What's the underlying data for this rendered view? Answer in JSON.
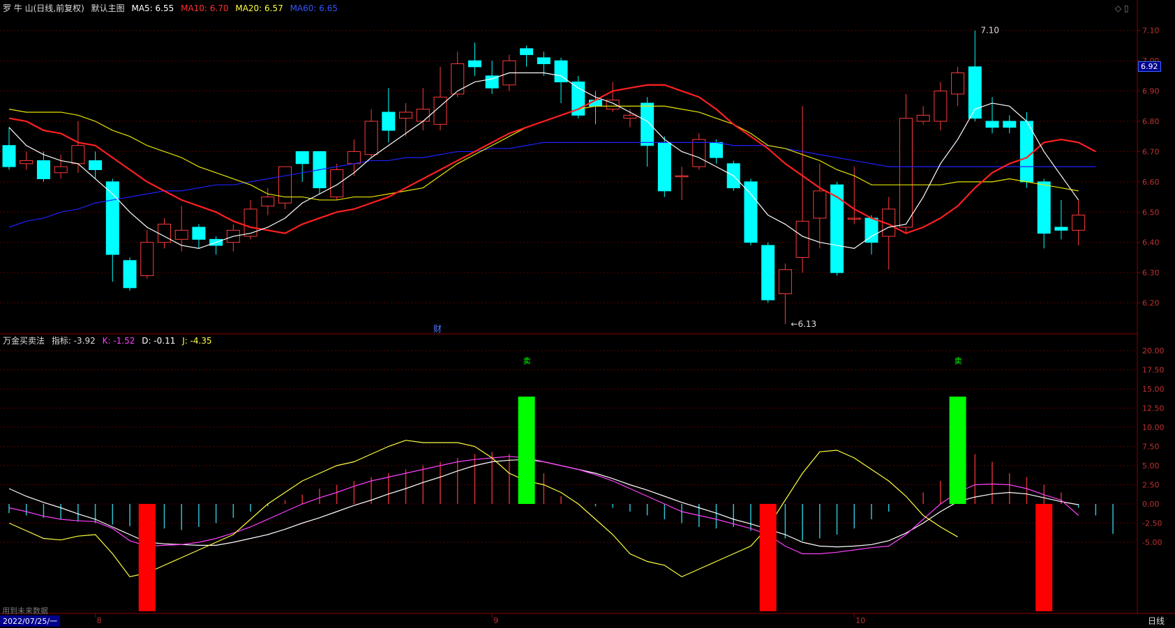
{
  "top_header": {
    "stock": "罗 牛 山(日线,前复权)",
    "main_chart": "默认主图",
    "ma5": "MA5: 6.55",
    "ma10": "MA10: 6.70",
    "ma20": "MA20: 6.57",
    "ma60": "MA60: 6.65"
  },
  "sub_header": {
    "indicator": "万金买卖法",
    "value": "指标: -3.92",
    "k": "K: -1.52",
    "d": "D: -0.11",
    "j": "J: -4.35"
  },
  "price_badge": "6.92",
  "finance_mark": "财",
  "future_data_label": "用到未来数据",
  "date_box": "2022/07/25/一",
  "period_button": "日线",
  "colors": {
    "bg": "#000000",
    "up": "#ff3b3b",
    "down": "#00ffff",
    "ma5": "#ffffff",
    "ma10": "#ff2020",
    "ma20": "#e6e600",
    "ma60": "#2020ff",
    "k": "#ff40ff",
    "d": "#ffffff",
    "j": "#ffff40",
    "buy": "#ff0000",
    "sell": "#00ff00",
    "axis": "#8b0000"
  },
  "chart_data": [
    {
      "type": "candlestick",
      "ylim": [
        6.1,
        7.15
      ],
      "y_ticks": [
        "7.10",
        "7.00",
        "6.90",
        "6.80",
        "6.70",
        "6.60",
        "6.50",
        "6.40",
        "6.30",
        "6.20"
      ],
      "x_labels": [
        {
          "index": 5,
          "text": "8"
        },
        {
          "index": 28,
          "text": "9"
        },
        {
          "index": 49,
          "text": "10"
        }
      ],
      "annotations": [
        {
          "index": 56,
          "price": 7.1,
          "text": "7.10"
        },
        {
          "index": 45,
          "price": 6.13,
          "text": "6.13"
        }
      ],
      "candles": [
        [
          6.72,
          6.65,
          6.78,
          6.64
        ],
        [
          6.66,
          6.67,
          6.7,
          6.64
        ],
        [
          6.67,
          6.61,
          6.7,
          6.6
        ],
        [
          6.63,
          6.65,
          6.69,
          6.61
        ],
        [
          6.66,
          6.72,
          6.8,
          6.63
        ],
        [
          6.67,
          6.64,
          6.7,
          6.61
        ],
        [
          6.6,
          6.36,
          6.61,
          6.27
        ],
        [
          6.34,
          6.25,
          6.35,
          6.24
        ],
        [
          6.29,
          6.4,
          6.44,
          6.28
        ],
        [
          6.4,
          6.46,
          6.48,
          6.38
        ],
        [
          6.41,
          6.44,
          6.52,
          6.37
        ],
        [
          6.45,
          6.41,
          6.46,
          6.38
        ],
        [
          6.41,
          6.39,
          6.42,
          6.36
        ],
        [
          6.4,
          6.44,
          6.46,
          6.37
        ],
        [
          6.42,
          6.51,
          6.54,
          6.41
        ],
        [
          6.52,
          6.55,
          6.58,
          6.49
        ],
        [
          6.53,
          6.65,
          6.65,
          6.51
        ],
        [
          6.7,
          6.66,
          6.7,
          6.6
        ],
        [
          6.7,
          6.58,
          6.7,
          6.56
        ],
        [
          6.55,
          6.64,
          6.66,
          6.54
        ],
        [
          6.66,
          6.7,
          6.74,
          6.62
        ],
        [
          6.69,
          6.8,
          6.84,
          6.68
        ],
        [
          6.83,
          6.77,
          6.91,
          6.73
        ],
        [
          6.81,
          6.83,
          6.86,
          6.75
        ],
        [
          6.8,
          6.84,
          6.91,
          6.77
        ],
        [
          6.79,
          6.88,
          6.98,
          6.77
        ],
        [
          6.89,
          6.99,
          7.03,
          6.88
        ],
        [
          7.0,
          6.98,
          7.06,
          6.95
        ],
        [
          6.95,
          6.91,
          7.0,
          6.89
        ],
        [
          6.92,
          7.0,
          7.02,
          6.9
        ],
        [
          7.04,
          7.02,
          7.05,
          6.98
        ],
        [
          7.01,
          6.99,
          7.03,
          6.95
        ],
        [
          7.0,
          6.93,
          7.01,
          6.86
        ],
        [
          6.93,
          6.82,
          6.95,
          6.81
        ],
        [
          6.87,
          6.85,
          6.9,
          6.79
        ],
        [
          6.84,
          6.87,
          6.93,
          6.83
        ],
        [
          6.81,
          6.82,
          6.84,
          6.78
        ],
        [
          6.86,
          6.72,
          6.88,
          6.65
        ],
        [
          6.73,
          6.57,
          6.75,
          6.55
        ],
        [
          6.62,
          6.62,
          6.65,
          6.54
        ],
        [
          6.65,
          6.74,
          6.76,
          6.64
        ],
        [
          6.73,
          6.68,
          6.74,
          6.66
        ],
        [
          6.66,
          6.58,
          6.67,
          6.57
        ],
        [
          6.6,
          6.4,
          6.61,
          6.39
        ],
        [
          6.39,
          6.21,
          6.4,
          6.2
        ],
        [
          6.23,
          6.31,
          6.33,
          6.13
        ],
        [
          6.35,
          6.47,
          6.85,
          6.3
        ],
        [
          6.48,
          6.57,
          6.66,
          6.38
        ],
        [
          6.59,
          6.3,
          6.6,
          6.29
        ],
        [
          6.48,
          6.48,
          6.65,
          6.46
        ],
        [
          6.48,
          6.4,
          6.49,
          6.36
        ],
        [
          6.42,
          6.51,
          6.55,
          6.31
        ],
        [
          6.45,
          6.81,
          6.89,
          6.43
        ],
        [
          6.8,
          6.82,
          6.85,
          6.79
        ],
        [
          6.8,
          6.9,
          6.93,
          6.77
        ],
        [
          6.89,
          6.96,
          6.98,
          6.85
        ],
        [
          6.98,
          6.81,
          7.1,
          6.8
        ],
        [
          6.8,
          6.78,
          6.88,
          6.76
        ],
        [
          6.8,
          6.78,
          6.82,
          6.76
        ],
        [
          6.8,
          6.6,
          6.83,
          6.58
        ],
        [
          6.6,
          6.43,
          6.61,
          6.38
        ],
        [
          6.45,
          6.44,
          6.54,
          6.41
        ],
        [
          6.44,
          6.49,
          6.54,
          6.39
        ]
      ],
      "ma5": [
        6.78,
        6.72,
        6.69,
        6.67,
        6.66,
        6.61,
        6.56,
        6.5,
        6.45,
        6.42,
        6.39,
        6.38,
        6.4,
        6.42,
        6.43,
        6.45,
        6.48,
        6.53,
        6.56,
        6.59,
        6.63,
        6.68,
        6.72,
        6.76,
        6.8,
        6.85,
        6.9,
        6.93,
        6.94,
        6.96,
        6.96,
        6.96,
        6.95,
        6.91,
        6.88,
        6.86,
        6.83,
        6.8,
        6.74,
        6.7,
        6.68,
        6.65,
        6.62,
        6.56,
        6.49,
        6.46,
        6.42,
        6.4,
        6.39,
        6.38,
        6.42,
        6.45,
        6.46,
        6.55,
        6.66,
        6.74,
        6.84,
        6.86,
        6.85,
        6.8,
        6.7,
        6.62,
        6.54
      ],
      "ma10": [
        6.81,
        6.8,
        6.77,
        6.76,
        6.73,
        6.72,
        6.68,
        6.64,
        6.6,
        6.57,
        6.54,
        6.52,
        6.5,
        6.47,
        6.45,
        6.44,
        6.43,
        6.46,
        6.48,
        6.5,
        6.51,
        6.53,
        6.55,
        6.58,
        6.61,
        6.64,
        6.67,
        6.7,
        6.73,
        6.76,
        6.78,
        6.8,
        6.82,
        6.84,
        6.87,
        6.9,
        6.91,
        6.92,
        6.92,
        6.9,
        6.88,
        6.84,
        6.79,
        6.75,
        6.71,
        6.66,
        6.62,
        6.58,
        6.55,
        6.51,
        6.48,
        6.46,
        6.43,
        6.45,
        6.48,
        6.52,
        6.58,
        6.63,
        6.66,
        6.68,
        6.73,
        6.74,
        6.73,
        6.7
      ],
      "ma20": [
        6.84,
        6.83,
        6.83,
        6.83,
        6.82,
        6.8,
        6.77,
        6.75,
        6.72,
        6.7,
        6.68,
        6.65,
        6.63,
        6.61,
        6.59,
        6.56,
        6.55,
        6.55,
        6.54,
        6.54,
        6.55,
        6.55,
        6.56,
        6.57,
        6.58,
        6.62,
        6.66,
        6.69,
        6.72,
        6.75,
        6.78,
        6.8,
        6.82,
        6.84,
        6.85,
        6.85,
        6.85,
        6.85,
        6.85,
        6.84,
        6.83,
        6.81,
        6.79,
        6.76,
        6.72,
        6.71,
        6.69,
        6.67,
        6.64,
        6.62,
        6.59,
        6.59,
        6.59,
        6.59,
        6.59,
        6.6,
        6.6,
        6.6,
        6.61,
        6.6,
        6.59,
        6.58,
        6.57
      ],
      "ma60": [
        6.45,
        6.47,
        6.48,
        6.5,
        6.51,
        6.53,
        6.54,
        6.55,
        6.56,
        6.57,
        6.57,
        6.58,
        6.59,
        6.59,
        6.6,
        6.61,
        6.62,
        6.63,
        6.64,
        6.65,
        6.66,
        6.67,
        6.67,
        6.68,
        6.68,
        6.69,
        6.7,
        6.7,
        6.71,
        6.71,
        6.72,
        6.73,
        6.73,
        6.73,
        6.73,
        6.73,
        6.73,
        6.73,
        6.73,
        6.73,
        6.73,
        6.73,
        6.72,
        6.72,
        6.72,
        6.71,
        6.7,
        6.69,
        6.68,
        6.67,
        6.66,
        6.65,
        6.65,
        6.65,
        6.65,
        6.65,
        6.65,
        6.65,
        6.65,
        6.65,
        6.65,
        6.65,
        6.65,
        6.65
      ]
    },
    {
      "type": "indicator",
      "ylim": [
        -14,
        21
      ],
      "y_ticks": [
        "20.00",
        "17.50",
        "15.00",
        "12.50",
        "10.00",
        "7.50",
        "5.00",
        "2.50",
        "0.00",
        "-2.50",
        "-5.00"
      ],
      "sell_label": "卖",
      "hist": [
        -1.2,
        -1.5,
        -1.8,
        -2.0,
        -2.3,
        -2.5,
        -2.7,
        -2.9,
        -3.0,
        -3.2,
        -3.4,
        -3.0,
        -2.5,
        -1.8,
        -1.0,
        -0.3,
        0.5,
        1.2,
        2.0,
        2.5,
        3.0,
        3.5,
        4.0,
        4.5,
        5.0,
        5.5,
        6.0,
        6.5,
        6.8,
        6.5,
        5.5,
        4.0,
        1.0,
        0.0,
        -0.3,
        -0.5,
        -1.0,
        -1.5,
        -2.0,
        -2.5,
        -3.0,
        -3.2,
        -3.0,
        -3.5,
        -4.0,
        -4.5,
        -4.8,
        -4.5,
        -4.0,
        -3.2,
        -2.0,
        -1.0,
        0.0,
        1.5,
        3.0,
        5.0,
        6.5,
        5.5,
        4.0,
        3.5,
        2.5,
        1.5,
        -0.5,
        -1.5,
        -3.9
      ],
      "k": [
        -0.5,
        -1.0,
        -1.6,
        -2.0,
        -2.2,
        -2.3,
        -3.2,
        -4.8,
        -5.5,
        -5.4,
        -5.3,
        -5.0,
        -4.5,
        -3.8,
        -3.0,
        -2.0,
        -1.0,
        0.0,
        0.8,
        1.5,
        2.3,
        3.0,
        3.5,
        4.0,
        4.5,
        5.0,
        5.5,
        5.8,
        6.0,
        6.2,
        6.0,
        5.5,
        5.0,
        4.5,
        3.8,
        3.0,
        2.0,
        1.0,
        0.0,
        -1.0,
        -1.5,
        -2.0,
        -2.6,
        -3.2,
        -4.0,
        -5.5,
        -6.5,
        -6.5,
        -6.3,
        -6.0,
        -5.7,
        -5.5,
        -4.0,
        -2.0,
        0.0,
        1.5,
        2.5,
        2.6,
        2.5,
        2.0,
        1.2,
        0.5,
        -1.5
      ],
      "d": [
        2.0,
        1.0,
        0.2,
        -0.5,
        -1.3,
        -2.0,
        -3.0,
        -4.0,
        -5.0,
        -5.2,
        -5.3,
        -5.4,
        -5.4,
        -5.0,
        -4.5,
        -4.0,
        -3.3,
        -2.5,
        -1.8,
        -1.0,
        -0.2,
        0.5,
        1.3,
        2.0,
        2.8,
        3.5,
        4.3,
        5.0,
        5.5,
        5.7,
        5.8,
        5.5,
        5.0,
        4.5,
        4.0,
        3.3,
        2.5,
        1.8,
        1.0,
        0.2,
        -0.5,
        -1.2,
        -2.0,
        -2.6,
        -3.3,
        -4.0,
        -5.0,
        -5.5,
        -5.6,
        -5.5,
        -5.3,
        -4.8,
        -3.8,
        -2.5,
        -1.0,
        0.3,
        0.9,
        1.3,
        1.5,
        1.3,
        0.8,
        0.3,
        -0.1
      ],
      "j": [
        -2.5,
        -3.5,
        -4.5,
        -4.7,
        -4.2,
        -4.0,
        -6.5,
        -9.5,
        -9.0,
        -8.0,
        -7.0,
        -6.0,
        -5.0,
        -4.0,
        -2.0,
        0.0,
        1.5,
        3.0,
        4.0,
        5.0,
        5.5,
        6.5,
        7.5,
        8.3,
        8.0,
        8.0,
        8.0,
        7.5,
        6.0,
        4.0,
        3.0,
        2.5,
        1.5,
        0.0,
        -2.0,
        -4.0,
        -6.5,
        -7.5,
        -8.0,
        -9.5,
        -8.5,
        -7.5,
        -6.5,
        -5.5,
        -3.0,
        0.5,
        4.0,
        6.8,
        7.0,
        6.0,
        4.5,
        3.0,
        1.0,
        -1.5,
        -3.0,
        -4.3
      ],
      "signals": [
        {
          "index": 8,
          "type": "buy",
          "top": 0,
          "bottom": -14
        },
        {
          "index": 30,
          "type": "sell",
          "top": 14,
          "bottom": 0
        },
        {
          "index": 44,
          "type": "buy",
          "top": 0,
          "bottom": -14
        },
        {
          "index": 55,
          "type": "sell",
          "top": 14,
          "bottom": 0
        },
        {
          "index": 60,
          "type": "buy",
          "top": 0,
          "bottom": -14
        }
      ]
    }
  ]
}
